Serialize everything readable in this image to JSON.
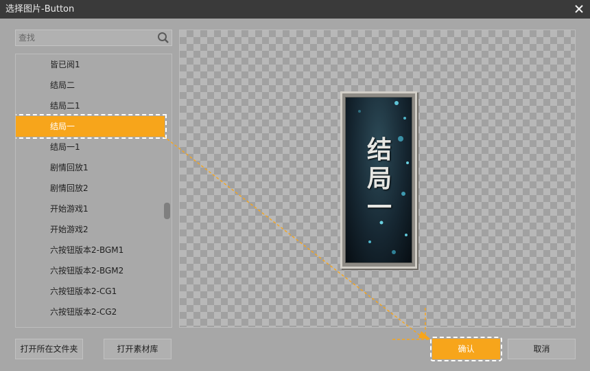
{
  "window": {
    "title": "选择图片-Button"
  },
  "search": {
    "placeholder": "查找"
  },
  "list": {
    "items": [
      {
        "label": "皆已阅1"
      },
      {
        "label": "结局二"
      },
      {
        "label": "结局二1"
      },
      {
        "label": "结局一",
        "selected": true
      },
      {
        "label": "结局一1"
      },
      {
        "label": "剧情回放1"
      },
      {
        "label": "剧情回放2"
      },
      {
        "label": "开始游戏1"
      },
      {
        "label": "开始游戏2"
      },
      {
        "label": "六按钮版本2-BGM1"
      },
      {
        "label": "六按钮版本2-BGM2"
      },
      {
        "label": "六按钮版本2-CG1"
      },
      {
        "label": "六按钮版本2-CG2"
      }
    ],
    "scroll_position": 0.58
  },
  "preview": {
    "image_text": [
      "结",
      "局",
      "一"
    ]
  },
  "footer": {
    "open_folder_label": "打开所在文件夹",
    "open_library_label": "打开素材库",
    "confirm_label": "确认",
    "cancel_label": "取消"
  },
  "colors": {
    "accent": "#f7a51b",
    "titlebar": "#3a3a3a",
    "dialog_bg": "#a7a7a7"
  },
  "icons": [
    "close-icon",
    "search-icon"
  ]
}
